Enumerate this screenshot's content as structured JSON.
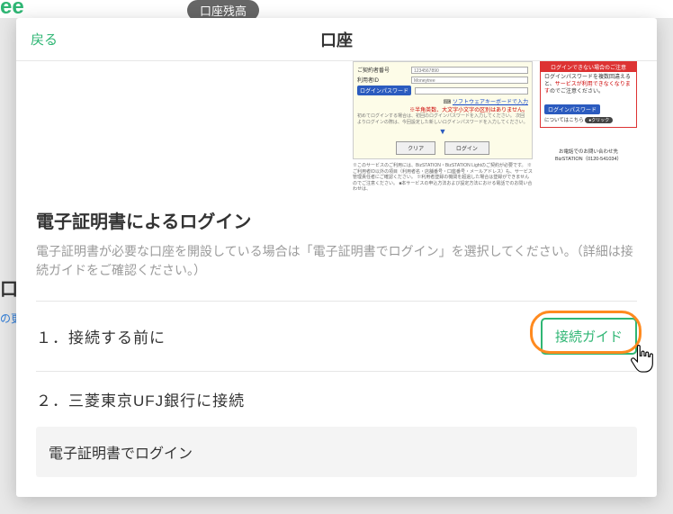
{
  "background": {
    "logo_fragment": "ee",
    "pill_label": "口座残高",
    "side_header": "口",
    "side_link": "の更"
  },
  "modal": {
    "back_label": "戻る",
    "title": "口座",
    "login_preview": {
      "contract_label": "ご契約者番号",
      "contract_value": "1234567890",
      "user_label": "利用者ID",
      "user_value": "Moneytree",
      "password_label": "ログインパスワード",
      "sw_keyboard": "ソフトウェアキーボードで入力",
      "note_red": "※半角英数、大文字小文字の区別はありません。",
      "note_muted": "初めてログインする場合は、初回のログインパスワードを入力してください。\n次回よりログインの際は、今回設定した新しいログインパスワードを入力してください。",
      "clear_btn": "クリア",
      "login_btn": "ログイン",
      "footer": "※このサービスのご利用には、BizSTATION・BizSTATION Lightのご契約が必要です。\n※ご利用者ID以外の項目（利用者名・店舗番号・口座番号・メールアドレス）も、サービス管理責任者にご確認ください。\n※利用者登録の機関を超過した場合は登録ができませんのでご注意ください。\n■本サービスの申込方法および設定方法における電話でのお問い合わせは、"
    },
    "notice_preview": {
      "title": "ログインできない場合のご注意",
      "body_pre": "ログインパスワードを複数回違えると、",
      "body_red": "サービスが利用できなくなります",
      "body_post": "のでご注意ください。",
      "pwd_btn": "ログインパスワード",
      "below": "についてはこちら",
      "click_pill": "●クリック",
      "contact_title": "お電話でのお問い合わせ先",
      "contact_num": "BizSTATION（0120-541034）"
    },
    "cert_section": {
      "title": "電子証明書によるログイン",
      "desc": "電子証明書が必要な口座を開設している場合は「電子証明書でログイン」を選択してください。（詳細は接続ガイドをご確認ください。）"
    },
    "steps": [
      {
        "label": "１．接続する前に",
        "guide_label": "接続ガイド"
      },
      {
        "label": "２．三菱東京UFJ銀行に接続"
      }
    ],
    "cert_login_item": "電子証明書でログイン"
  }
}
